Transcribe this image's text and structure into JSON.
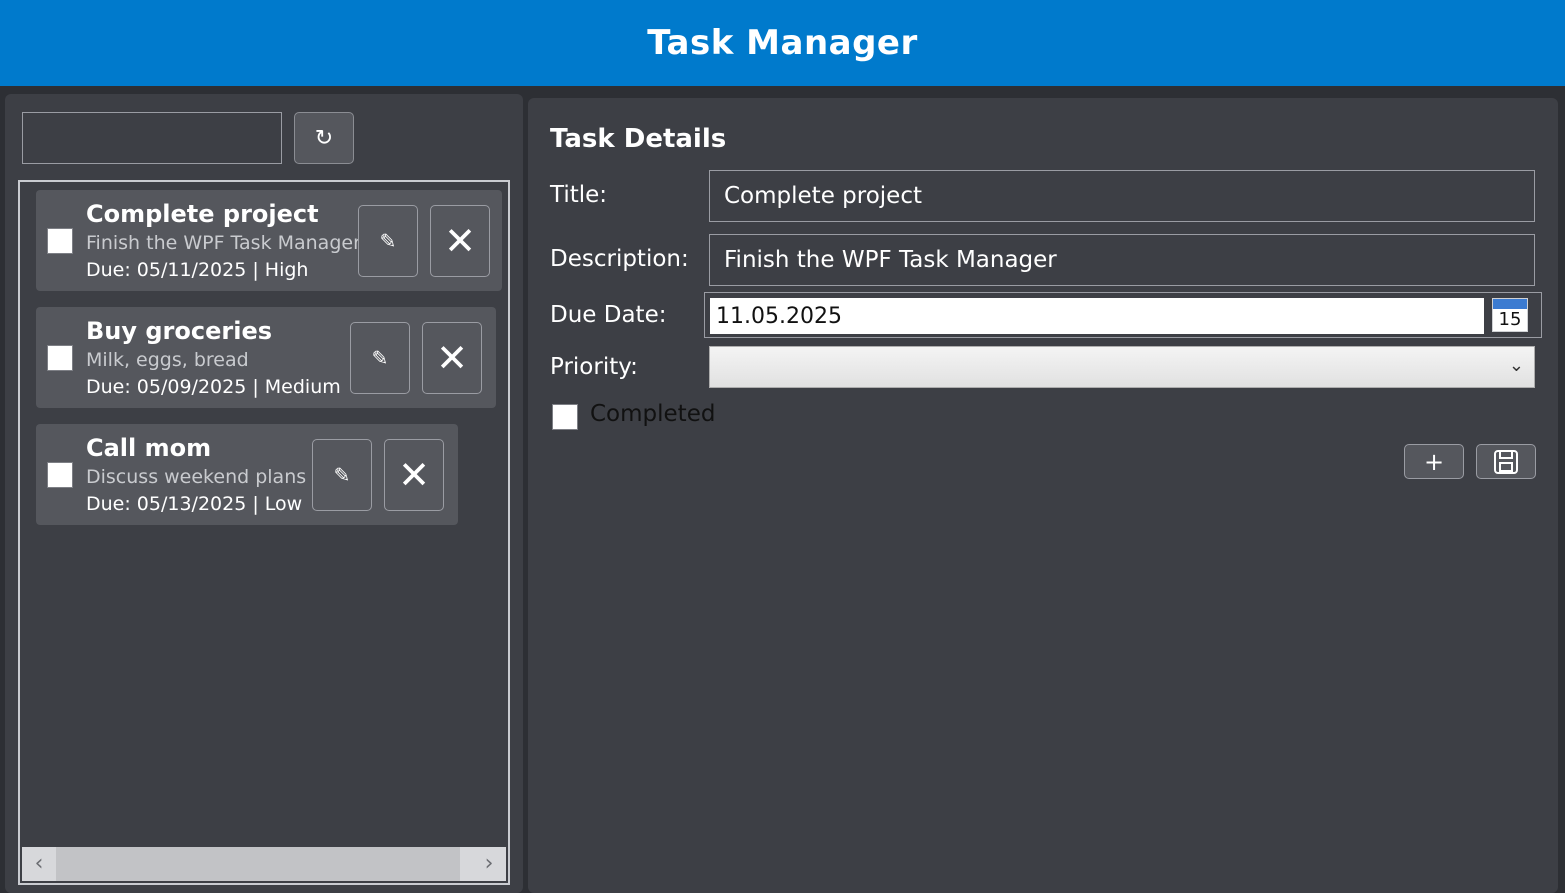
{
  "header": {
    "title": "Task Manager"
  },
  "search": {
    "value": "",
    "placeholder": ""
  },
  "refresh": {
    "icon": "refresh-icon",
    "glyph": "↻"
  },
  "tasks": [
    {
      "title": "Complete project",
      "description": "Finish the WPF Task Manager",
      "due": "Due: 05/11/2025  |  High",
      "completed": false,
      "selected": true
    },
    {
      "title": "Buy groceries",
      "description": "Milk, eggs, bread",
      "due": "Due: 05/09/2025  |  Medium",
      "completed": false,
      "selected": false
    },
    {
      "title": "Call mom",
      "description": "Discuss weekend plans",
      "due": "Due: 05/13/2025  |  Low",
      "completed": false,
      "selected": false
    }
  ],
  "task_actions": {
    "edit_glyph": "✎",
    "delete_glyph": "✕"
  },
  "scrollbar": {
    "left_glyph": "‹",
    "right_glyph": "›"
  },
  "details": {
    "heading": "Task Details",
    "title_label": "Title:",
    "title_value": "Complete project",
    "description_label": "Description:",
    "description_value": "Finish the WPF Task Manager",
    "due_label": "Due Date:",
    "due_value": "11.05.2025",
    "calendar_day": "15",
    "priority_label": "Priority:",
    "priority_value": "",
    "completed_label": "Completed",
    "chevron_glyph": "⌄",
    "add_glyph": "+",
    "save_glyph": "💾"
  },
  "colors": {
    "accent": "#007acc",
    "panel": "#3d3f45",
    "card": "#55575d",
    "background": "#2d2f34"
  }
}
